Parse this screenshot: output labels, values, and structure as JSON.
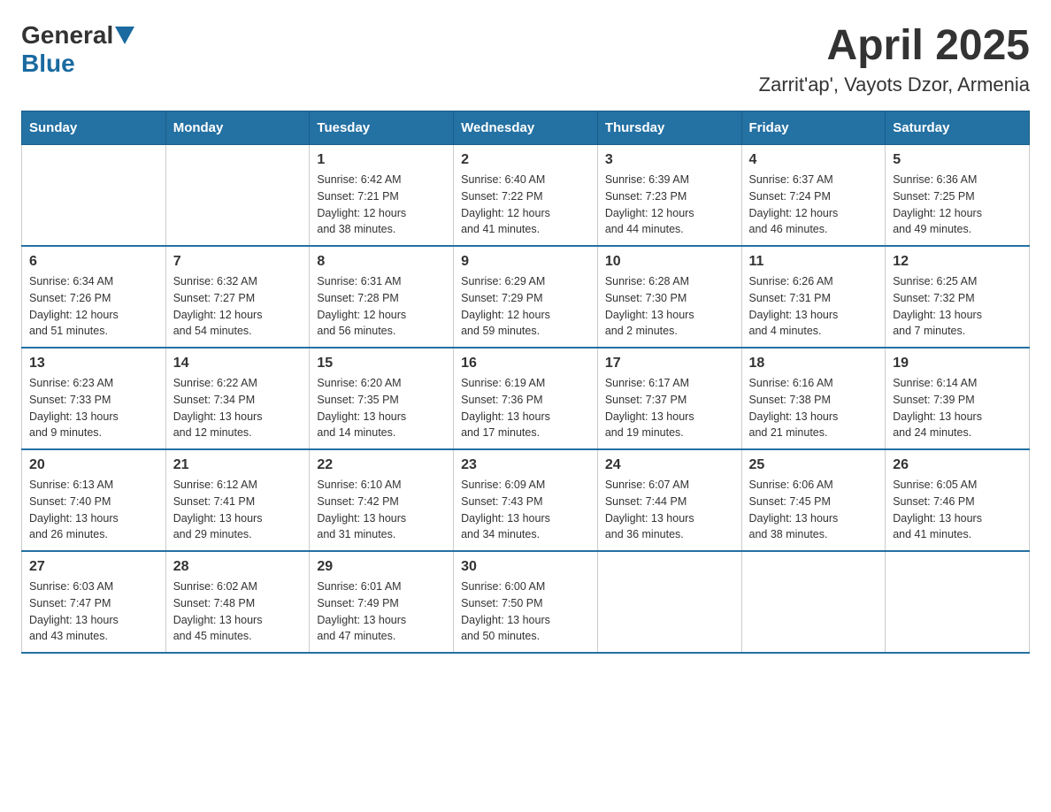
{
  "header": {
    "logo_general": "General",
    "logo_blue": "Blue",
    "title": "April 2025",
    "subtitle": "Zarrit'ap', Vayots Dzor, Armenia"
  },
  "days_of_week": [
    "Sunday",
    "Monday",
    "Tuesday",
    "Wednesday",
    "Thursday",
    "Friday",
    "Saturday"
  ],
  "weeks": [
    [
      {
        "day": "",
        "info": ""
      },
      {
        "day": "",
        "info": ""
      },
      {
        "day": "1",
        "info": "Sunrise: 6:42 AM\nSunset: 7:21 PM\nDaylight: 12 hours\nand 38 minutes."
      },
      {
        "day": "2",
        "info": "Sunrise: 6:40 AM\nSunset: 7:22 PM\nDaylight: 12 hours\nand 41 minutes."
      },
      {
        "day": "3",
        "info": "Sunrise: 6:39 AM\nSunset: 7:23 PM\nDaylight: 12 hours\nand 44 minutes."
      },
      {
        "day": "4",
        "info": "Sunrise: 6:37 AM\nSunset: 7:24 PM\nDaylight: 12 hours\nand 46 minutes."
      },
      {
        "day": "5",
        "info": "Sunrise: 6:36 AM\nSunset: 7:25 PM\nDaylight: 12 hours\nand 49 minutes."
      }
    ],
    [
      {
        "day": "6",
        "info": "Sunrise: 6:34 AM\nSunset: 7:26 PM\nDaylight: 12 hours\nand 51 minutes."
      },
      {
        "day": "7",
        "info": "Sunrise: 6:32 AM\nSunset: 7:27 PM\nDaylight: 12 hours\nand 54 minutes."
      },
      {
        "day": "8",
        "info": "Sunrise: 6:31 AM\nSunset: 7:28 PM\nDaylight: 12 hours\nand 56 minutes."
      },
      {
        "day": "9",
        "info": "Sunrise: 6:29 AM\nSunset: 7:29 PM\nDaylight: 12 hours\nand 59 minutes."
      },
      {
        "day": "10",
        "info": "Sunrise: 6:28 AM\nSunset: 7:30 PM\nDaylight: 13 hours\nand 2 minutes."
      },
      {
        "day": "11",
        "info": "Sunrise: 6:26 AM\nSunset: 7:31 PM\nDaylight: 13 hours\nand 4 minutes."
      },
      {
        "day": "12",
        "info": "Sunrise: 6:25 AM\nSunset: 7:32 PM\nDaylight: 13 hours\nand 7 minutes."
      }
    ],
    [
      {
        "day": "13",
        "info": "Sunrise: 6:23 AM\nSunset: 7:33 PM\nDaylight: 13 hours\nand 9 minutes."
      },
      {
        "day": "14",
        "info": "Sunrise: 6:22 AM\nSunset: 7:34 PM\nDaylight: 13 hours\nand 12 minutes."
      },
      {
        "day": "15",
        "info": "Sunrise: 6:20 AM\nSunset: 7:35 PM\nDaylight: 13 hours\nand 14 minutes."
      },
      {
        "day": "16",
        "info": "Sunrise: 6:19 AM\nSunset: 7:36 PM\nDaylight: 13 hours\nand 17 minutes."
      },
      {
        "day": "17",
        "info": "Sunrise: 6:17 AM\nSunset: 7:37 PM\nDaylight: 13 hours\nand 19 minutes."
      },
      {
        "day": "18",
        "info": "Sunrise: 6:16 AM\nSunset: 7:38 PM\nDaylight: 13 hours\nand 21 minutes."
      },
      {
        "day": "19",
        "info": "Sunrise: 6:14 AM\nSunset: 7:39 PM\nDaylight: 13 hours\nand 24 minutes."
      }
    ],
    [
      {
        "day": "20",
        "info": "Sunrise: 6:13 AM\nSunset: 7:40 PM\nDaylight: 13 hours\nand 26 minutes."
      },
      {
        "day": "21",
        "info": "Sunrise: 6:12 AM\nSunset: 7:41 PM\nDaylight: 13 hours\nand 29 minutes."
      },
      {
        "day": "22",
        "info": "Sunrise: 6:10 AM\nSunset: 7:42 PM\nDaylight: 13 hours\nand 31 minutes."
      },
      {
        "day": "23",
        "info": "Sunrise: 6:09 AM\nSunset: 7:43 PM\nDaylight: 13 hours\nand 34 minutes."
      },
      {
        "day": "24",
        "info": "Sunrise: 6:07 AM\nSunset: 7:44 PM\nDaylight: 13 hours\nand 36 minutes."
      },
      {
        "day": "25",
        "info": "Sunrise: 6:06 AM\nSunset: 7:45 PM\nDaylight: 13 hours\nand 38 minutes."
      },
      {
        "day": "26",
        "info": "Sunrise: 6:05 AM\nSunset: 7:46 PM\nDaylight: 13 hours\nand 41 minutes."
      }
    ],
    [
      {
        "day": "27",
        "info": "Sunrise: 6:03 AM\nSunset: 7:47 PM\nDaylight: 13 hours\nand 43 minutes."
      },
      {
        "day": "28",
        "info": "Sunrise: 6:02 AM\nSunset: 7:48 PM\nDaylight: 13 hours\nand 45 minutes."
      },
      {
        "day": "29",
        "info": "Sunrise: 6:01 AM\nSunset: 7:49 PM\nDaylight: 13 hours\nand 47 minutes."
      },
      {
        "day": "30",
        "info": "Sunrise: 6:00 AM\nSunset: 7:50 PM\nDaylight: 13 hours\nand 50 minutes."
      },
      {
        "day": "",
        "info": ""
      },
      {
        "day": "",
        "info": ""
      },
      {
        "day": "",
        "info": ""
      }
    ]
  ]
}
